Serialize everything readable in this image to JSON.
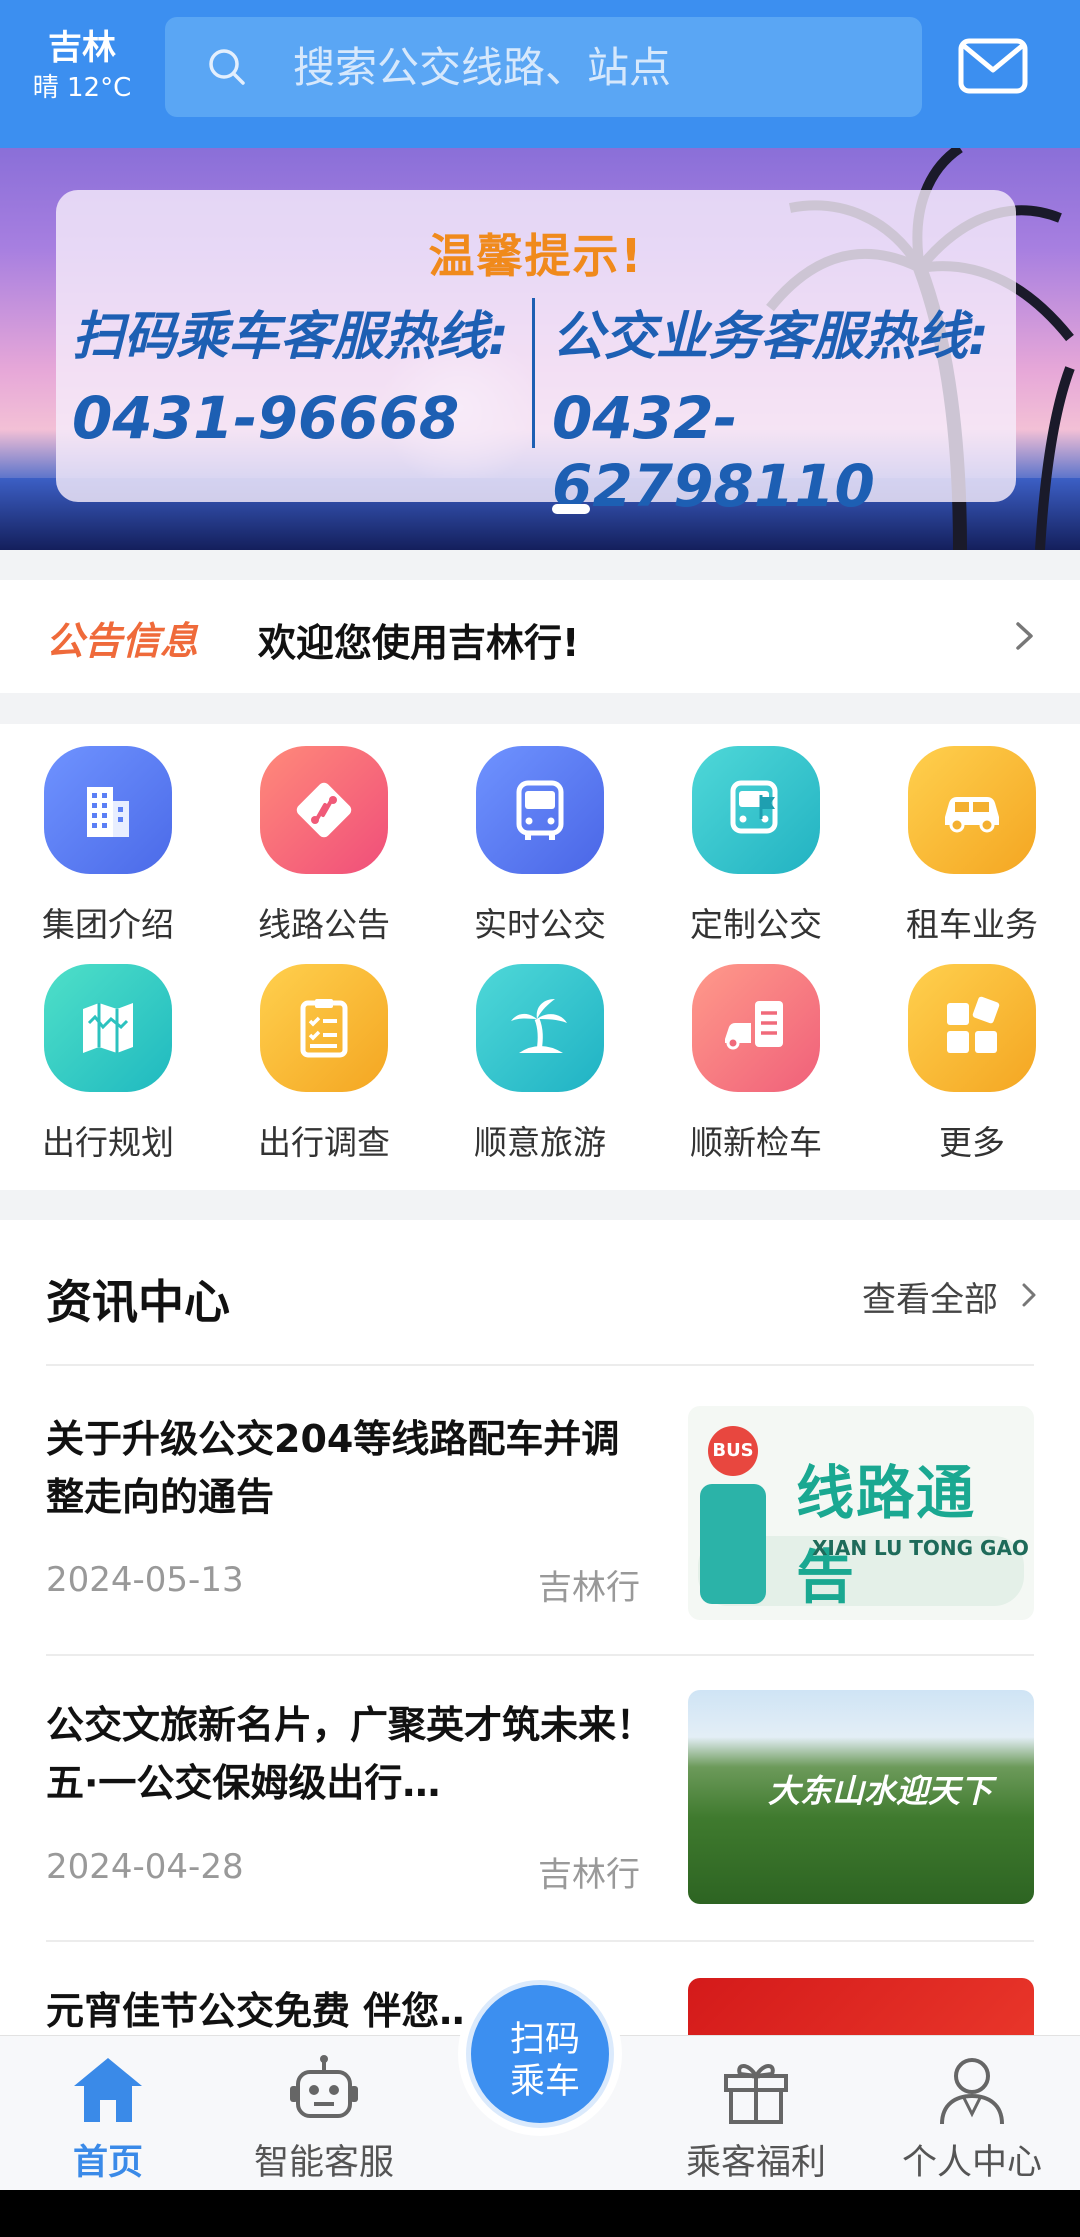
{
  "header": {
    "city": "吉林",
    "weather": "晴 12°C",
    "search_placeholder": "搜索公交线路、站点"
  },
  "banner": {
    "title": "温馨提示!",
    "left_label": "扫码乘车客服热线:",
    "left_number": "0431-96668",
    "right_label": "公交业务客服热线:",
    "right_number": "0432-62798110"
  },
  "announcement": {
    "tag": "公告信息",
    "message": "欢迎您使用吉林行!"
  },
  "services": [
    {
      "label": "集团介绍",
      "icon": "building-icon",
      "color": "#5b7ff5"
    },
    {
      "label": "线路公告",
      "icon": "route-icon",
      "color": "#f56a7a"
    },
    {
      "label": "实时公交",
      "icon": "bus-icon",
      "color": "#5a7ff5"
    },
    {
      "label": "定制公交",
      "icon": "custom-bus-icon",
      "color": "#32c4c8"
    },
    {
      "label": "租车业务",
      "icon": "car-icon",
      "color": "#f6b62d"
    },
    {
      "label": "出行规划",
      "icon": "map-icon",
      "color": "#2ec9c0"
    },
    {
      "label": "出行调查",
      "icon": "clipboard-icon",
      "color": "#f6b62d"
    },
    {
      "label": "顺意旅游",
      "icon": "palm-tree-icon",
      "color": "#29c2c6"
    },
    {
      "label": "顺新检车",
      "icon": "car-inspection-icon",
      "color": "#f5727a"
    },
    {
      "label": "更多",
      "icon": "more-grid-icon",
      "color": "#f6b62d"
    }
  ],
  "news": {
    "title": "资讯中心",
    "more": "查看全部",
    "items": [
      {
        "title": "关于升级公交204等线路配车并调整走向的通告",
        "date": "2024-05-13",
        "source": "吉林行",
        "thumb_text": "线路通告",
        "thumb_sub": "XIAN LU TONG GAO",
        "thumb_badge": "BUS"
      },
      {
        "title": "公交文旅新名片，广聚英才筑未来！ 五·一公交保姆级出行…",
        "date": "2024-04-28",
        "source": "吉林行",
        "thumb_text": "大东山水迎天下"
      },
      {
        "title": "元宵佳节公交免费 伴您…",
        "date": "",
        "source": ""
      }
    ]
  },
  "nav": {
    "home": "首页",
    "service": "智能客服",
    "scan_line1": "扫码",
    "scan_line2": "乘车",
    "welfare": "乘客福利",
    "profile": "个人中心"
  }
}
